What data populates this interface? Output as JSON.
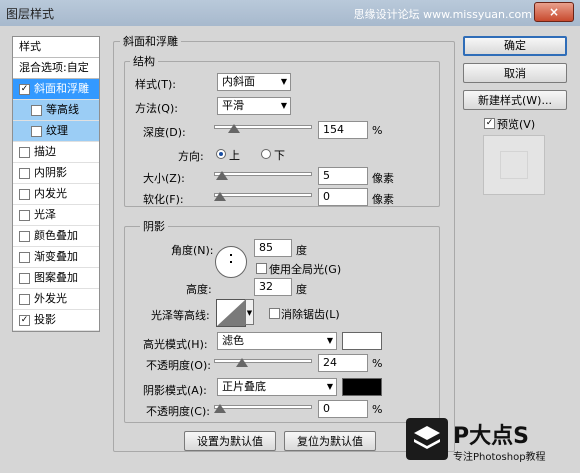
{
  "window": {
    "title": "图层样式",
    "watermark": "思缘设计论坛  www.missyuan.com",
    "close": "×"
  },
  "left_panel": {
    "header": "样式",
    "blend": "混合选项:自定",
    "items": [
      {
        "label": "斜面和浮雕",
        "checked": true
      },
      {
        "label": "等高线",
        "checked": false
      },
      {
        "label": "纹理",
        "checked": false
      },
      {
        "label": "描边",
        "checked": false
      },
      {
        "label": "内阴影",
        "checked": false
      },
      {
        "label": "内发光",
        "checked": false
      },
      {
        "label": "光泽",
        "checked": false
      },
      {
        "label": "颜色叠加",
        "checked": false
      },
      {
        "label": "渐变叠加",
        "checked": false
      },
      {
        "label": "图案叠加",
        "checked": false
      },
      {
        "label": "外发光",
        "checked": false
      },
      {
        "label": "投影",
        "checked": true
      }
    ],
    "check": "✓"
  },
  "bevel": {
    "title": "斜面和浮雕",
    "structure": {
      "title": "结构",
      "style_label": "样式(T):",
      "style_value": "内斜面",
      "technique_label": "方法(Q):",
      "technique_value": "平滑",
      "depth_label": "深度(D):",
      "depth_value": "154",
      "depth_unit": "%",
      "depth_frac": 0.154,
      "direction_label": "方向:",
      "dir_up": "上",
      "dir_down": "下",
      "size_label": "大小(Z):",
      "size_value": "5",
      "size_unit": "像素",
      "size_frac": 0.02,
      "soften_label": "软化(F):",
      "soften_value": "0",
      "soften_unit": "像素",
      "soften_frac": 0
    },
    "shading": {
      "title": "阴影",
      "angle_label": "角度(N):",
      "angle_value": "85",
      "angle_unit": "度",
      "global_light": "使用全局光(G)",
      "altitude_label": "高度:",
      "altitude_value": "32",
      "altitude_unit": "度",
      "gloss_label": "光泽等高线:",
      "antialias": "消除锯齿(L)",
      "highlight_label": "高光模式(H):",
      "highlight_value": "滤色",
      "highlight_color": "#ffffff",
      "hl_opacity_label": "不透明度(O):",
      "hl_opacity_value": "24",
      "hl_opacity_unit": "%",
      "hl_opacity_frac": 0.24,
      "shadow_label": "阴影模式(A):",
      "shadow_value": "正片叠底",
      "shadow_color": "#000000",
      "sh_opacity_label": "不透明度(C):",
      "sh_opacity_value": "0",
      "sh_opacity_unit": "%",
      "sh_opacity_frac": 0
    }
  },
  "buttons": {
    "ok": "确定",
    "cancel": "取消",
    "new_style": "新建样式(W)...",
    "preview": "预览(V)",
    "make_default": "设置为默认值",
    "reset_default": "复位为默认值"
  },
  "logo": {
    "text": "P大点S",
    "sub": "专注Photoshop教程"
  }
}
